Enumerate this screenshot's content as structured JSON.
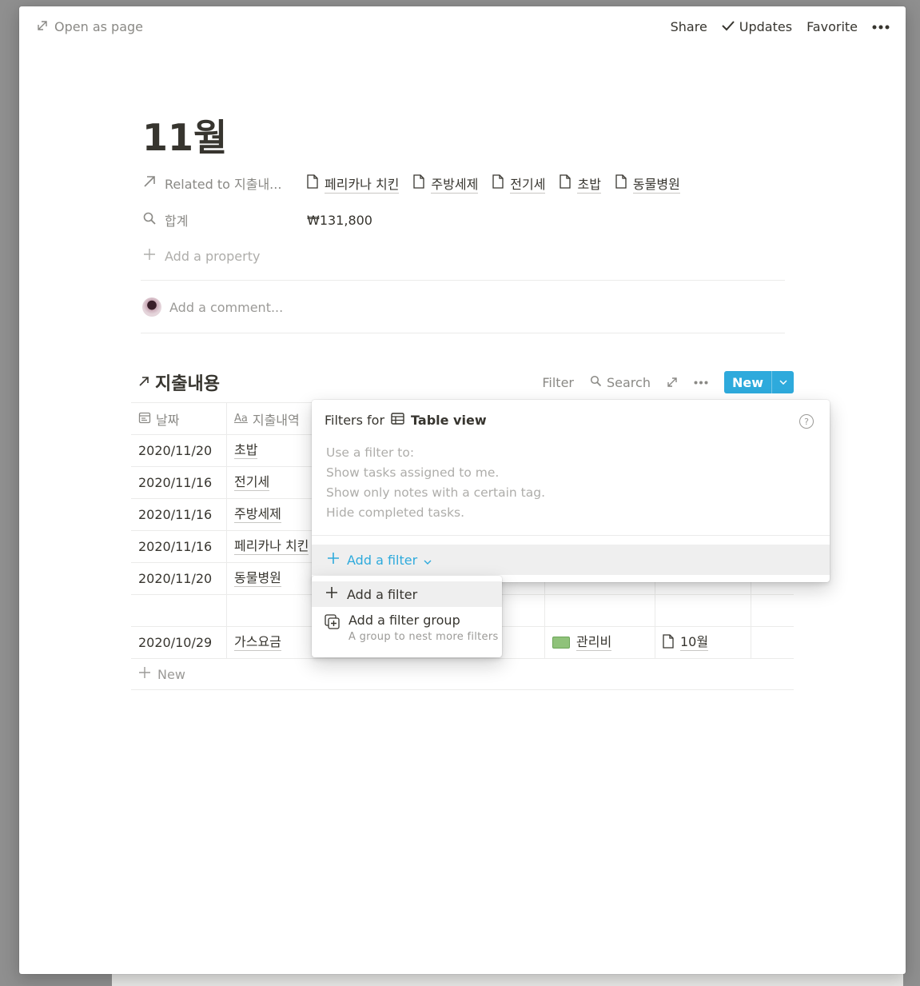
{
  "topbar": {
    "open_as_page": "Open as page",
    "share": "Share",
    "updates": "Updates",
    "favorite": "Favorite"
  },
  "page": {
    "title": "11월",
    "properties": {
      "related_label": "Related to 지출내...",
      "related_items": [
        "페리카나 치킨",
        "주방세제",
        "전기세",
        "초밥",
        "동물병원"
      ],
      "sum_label": "합계",
      "sum_value": "₩131,800",
      "add_property": "Add a property"
    },
    "comment_placeholder": "Add a comment..."
  },
  "database": {
    "title": "지출내용",
    "filter_label": "Filter",
    "search_label": "Search",
    "new_label": "New",
    "columns": [
      "날짜",
      "지출내역"
    ],
    "rows": [
      {
        "date": "2020/11/20",
        "item": "초밥",
        "category": "",
        "month": ""
      },
      {
        "date": "2020/11/16",
        "item": "전기세",
        "category": "",
        "month": ""
      },
      {
        "date": "2020/11/16",
        "item": "주방세제",
        "category": "",
        "month": ""
      },
      {
        "date": "2020/11/16",
        "item": "페리카나 치킨",
        "category": "",
        "month": ""
      },
      {
        "date": "2020/11/20",
        "item": "동물병원",
        "category": "",
        "month": ""
      },
      {
        "date": "",
        "item": "",
        "category": "",
        "month": ""
      },
      {
        "date": "2020/10/29",
        "item": "가스요금",
        "category": "관리비",
        "month": "10월"
      }
    ],
    "add_row_label": "New"
  },
  "filter_popup": {
    "title_prefix": "Filters for",
    "view_name": "Table view",
    "help": "?",
    "hints": [
      "Use a filter to:",
      "Show tasks assigned to me.",
      "Show only notes with a certain tag.",
      "Hide completed tasks."
    ],
    "add_filter": "Add a filter"
  },
  "dropdown": {
    "add_filter": "Add a filter",
    "add_group": "Add a filter group",
    "add_group_desc": "A group to nest more filters"
  },
  "colors": {
    "accent": "#2eaadc",
    "text": "#37352f",
    "muted": "#8a8985"
  }
}
